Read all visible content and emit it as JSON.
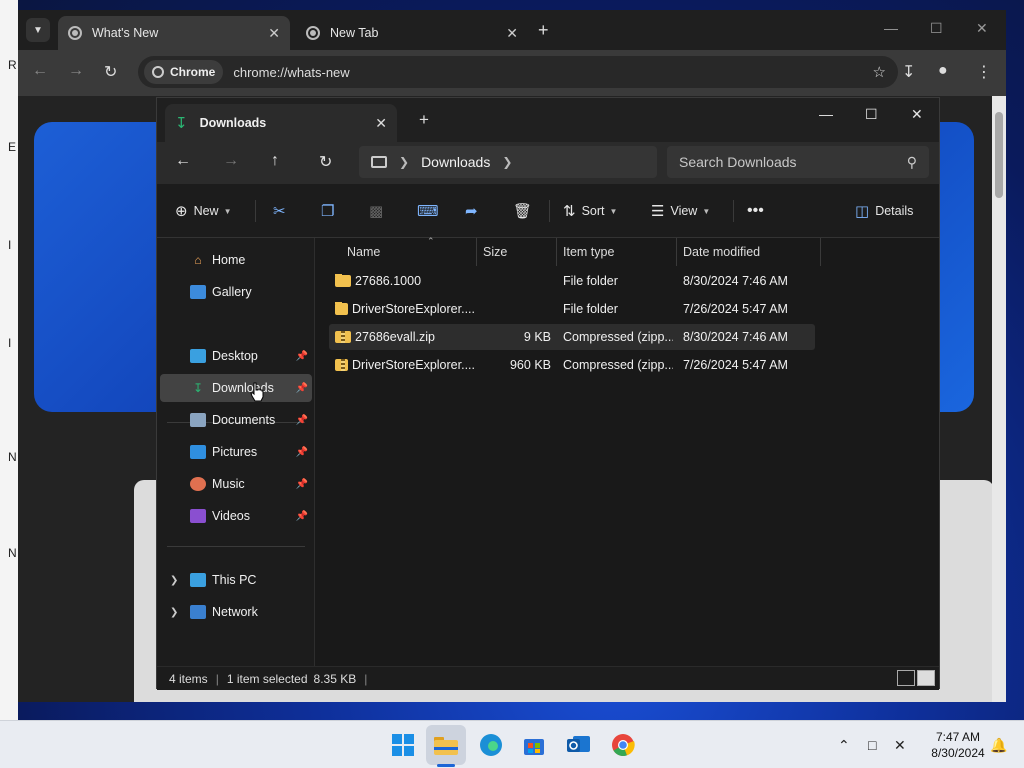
{
  "desktop": {
    "strip_letters": [
      "R",
      "E",
      "I",
      "I",
      "N",
      "N"
    ]
  },
  "chrome": {
    "tabs": [
      {
        "title": "What's New",
        "active": true
      },
      {
        "title": "New Tab",
        "active": false
      }
    ],
    "chip_label": "Chrome",
    "url": "chrome://whats-new"
  },
  "explorer": {
    "tab_title": "Downloads",
    "address": {
      "crumb": "Downloads"
    },
    "search_placeholder": "Search Downloads",
    "commands": {
      "new": "New",
      "sort": "Sort",
      "view": "View",
      "details": "Details"
    },
    "sidebar": [
      {
        "label": "Home",
        "icon": "home-icon",
        "pinned": false
      },
      {
        "label": "Gallery",
        "icon": "gallery-icon",
        "pinned": false
      },
      {
        "label": "Desktop",
        "icon": "desktop-icon",
        "pinned": true
      },
      {
        "label": "Downloads",
        "icon": "download-icon",
        "pinned": true,
        "selected": true
      },
      {
        "label": "Documents",
        "icon": "documents-icon",
        "pinned": true
      },
      {
        "label": "Pictures",
        "icon": "pictures-icon",
        "pinned": true
      },
      {
        "label": "Music",
        "icon": "music-icon",
        "pinned": true
      },
      {
        "label": "Videos",
        "icon": "videos-icon",
        "pinned": true
      },
      {
        "label": "This PC",
        "icon": "pc-icon",
        "expandable": true
      },
      {
        "label": "Network",
        "icon": "network-icon",
        "expandable": true
      }
    ],
    "columns": [
      "Name",
      "Size",
      "Item type",
      "Date modified"
    ],
    "files": [
      {
        "name": "27686.1000",
        "size": "",
        "type": "File folder",
        "date": "8/30/2024 7:46 AM",
        "kind": "folder"
      },
      {
        "name": "DriverStoreExplorer....",
        "size": "",
        "type": "File folder",
        "date": "7/26/2024 5:47 AM",
        "kind": "folder"
      },
      {
        "name": "27686evall.zip",
        "size": "9 KB",
        "type": "Compressed (zipp...",
        "date": "8/30/2024 7:46 AM",
        "kind": "zip",
        "selected": true
      },
      {
        "name": "DriverStoreExplorer....",
        "size": "960 KB",
        "type": "Compressed (zipp...",
        "date": "7/26/2024 5:47 AM",
        "kind": "zip"
      }
    ],
    "status": {
      "count": "4 items",
      "selected": "1 item selected",
      "size": "8.35 KB"
    }
  },
  "taskbar": {
    "time": "7:47 AM",
    "date": "8/30/2024",
    "colors": {
      "accent": "#1b65d6",
      "folder": "#f2c14e",
      "download_green": "#2bb673"
    }
  }
}
